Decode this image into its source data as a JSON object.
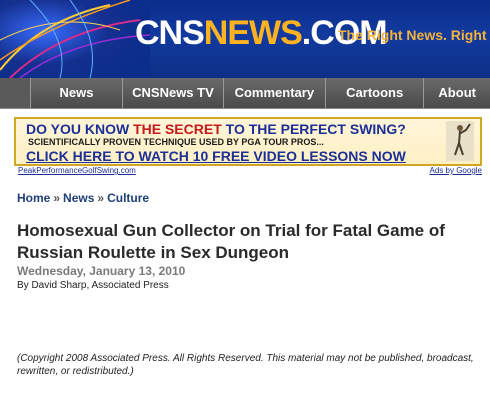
{
  "header": {
    "logo_white": "CNS",
    "logo_orange": "NEWS",
    "logo_suffix": ".COM",
    "tagline": "The Right News. Right"
  },
  "nav": {
    "items": [
      "News",
      "CNSNews TV",
      "Commentary",
      "Cartoons",
      "About"
    ]
  },
  "ad": {
    "line1_part1": "DO YOU KNOW ",
    "line1_highlight": "THE SECRET",
    "line1_part2": " TO THE PERFECT SWING?",
    "line2": "SCIENTIFICALLY PROVEN TECHNIQUE USED BY PGA TOUR PROS...",
    "line3": "CLICK HERE TO WATCH 10 FREE VIDEO LESSONS NOW",
    "source_link": "PeakPerformanceGolfSwing.com",
    "ads_by": "Ads by Google"
  },
  "breadcrumb": {
    "items": [
      "Home",
      "News",
      "Culture"
    ],
    "separator": "»"
  },
  "article": {
    "title": "Homosexual Gun Collector on Trial for Fatal Game of Russian Roulette in Sex Dungeon",
    "date": "Wednesday, January 13, 2010",
    "byline": "By David Sharp, Associated Press",
    "copyright": "(Copyright 2008 Associated Press. All Rights Reserved. This material may not be published, broadcast, rewritten, or redistributed.)"
  },
  "colors": {
    "header_blue": "#0d2f86",
    "logo_orange": "#ffb321",
    "nav_gray": "#555555",
    "ad_border": "#d0a624",
    "link_blue": "#1b2f97"
  }
}
